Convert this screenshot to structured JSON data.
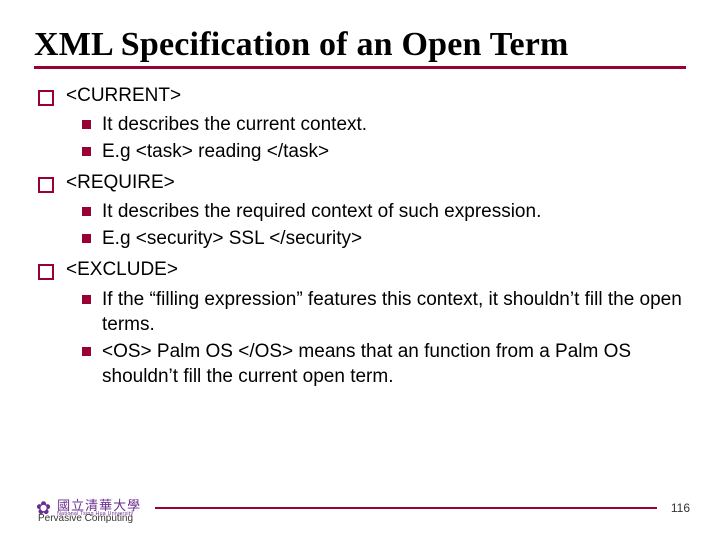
{
  "title": "XML Specification of an Open Term",
  "sections": [
    {
      "heading": "<CURRENT>",
      "items": [
        "It describes the current context.",
        "E.g <task> reading </task>"
      ]
    },
    {
      "heading": "<REQUIRE>",
      "items": [
        "It describes the required context of such expression.",
        "E.g <security> SSL </security>"
      ]
    },
    {
      "heading": "<EXCLUDE>",
      "items": [
        "If the “filling expression” features this context, it shouldn’t fill the open terms.",
        "<OS> Palm OS </OS> means that an function from a Palm OS shouldn’t fill the current open term."
      ]
    }
  ],
  "footer": {
    "label": "Pervasive Computing",
    "page_number": "116",
    "logo_cn": "國立清華大學",
    "logo_en": "National Tsing Hua University"
  }
}
